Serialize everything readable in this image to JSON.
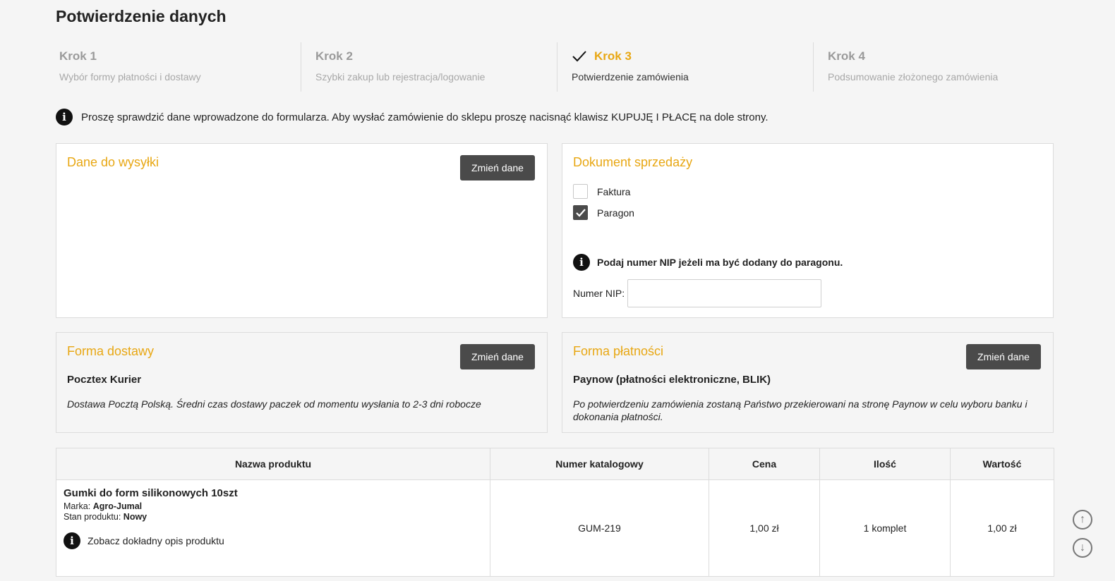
{
  "page": {
    "title": "Potwierdzenie danych"
  },
  "steps": [
    {
      "label": "Krok 1",
      "desc": "Wybór formy płatności i dostawy",
      "active": false
    },
    {
      "label": "Krok 2",
      "desc": "Szybki zakup lub rejestracja/logowanie",
      "active": false
    },
    {
      "label": "Krok 3",
      "desc": "Potwierdzenie zamówienia",
      "active": true
    },
    {
      "label": "Krok 4",
      "desc": "Podsumowanie złożonego zamówienia",
      "active": false
    }
  ],
  "info": {
    "icon": "info-icon",
    "text": "Proszę sprawdzić dane wprowadzone do formularza. Aby wysłać zamówienie do sklepu proszę nacisnąć klawisz KUPUJĘ I PŁACĘ na dole strony."
  },
  "shipping": {
    "title": "Dane do wysyłki",
    "change_label": "Zmień dane"
  },
  "document": {
    "title": "Dokument sprzedaży",
    "options": [
      {
        "label": "Faktura",
        "checked": false
      },
      {
        "label": "Paragon",
        "checked": true
      }
    ],
    "nip_info": "Podaj numer NIP jeżeli ma być dodany do paragonu.",
    "nip_label": "Numer NIP:",
    "nip_value": ""
  },
  "delivery": {
    "title": "Forma dostawy",
    "change_label": "Zmień dane",
    "name": "Pocztex Kurier",
    "desc": "Dostawa Pocztą Polską. Średni czas dostawy paczek od momentu wysłania to 2-3 dni robocze"
  },
  "payment": {
    "title": "Forma płatności",
    "change_label": "Zmień dane",
    "name": "Paynow (płatności elektroniczne, BLIK)",
    "desc": "Po potwierdzeniu zamówienia zostaną Państwo przekierowani na stronę Paynow w celu wyboru banku i dokonania płatności."
  },
  "table": {
    "headers": [
      "Nazwa produktu",
      "Numer katalogowy",
      "Cena",
      "Ilość",
      "Wartość"
    ],
    "rows": [
      {
        "name": "Gumki do form silikonowych 10szt",
        "brand_label": "Marka:",
        "brand": "Agro-Jumal",
        "condition_label": "Stan produktu:",
        "condition": "Nowy",
        "details_link": "Zobacz dokładny opis produktu",
        "catalog": "GUM-219",
        "price": "1,00 zł",
        "qty": "1 komplet",
        "value": "1,00 zł"
      }
    ]
  },
  "scroll": {
    "up_icon": "arrow-up-icon",
    "down_icon": "arrow-down-icon"
  },
  "colors": {
    "accent": "#e8a713",
    "button": "#4a4a4a",
    "background": "#f5f5f5"
  }
}
